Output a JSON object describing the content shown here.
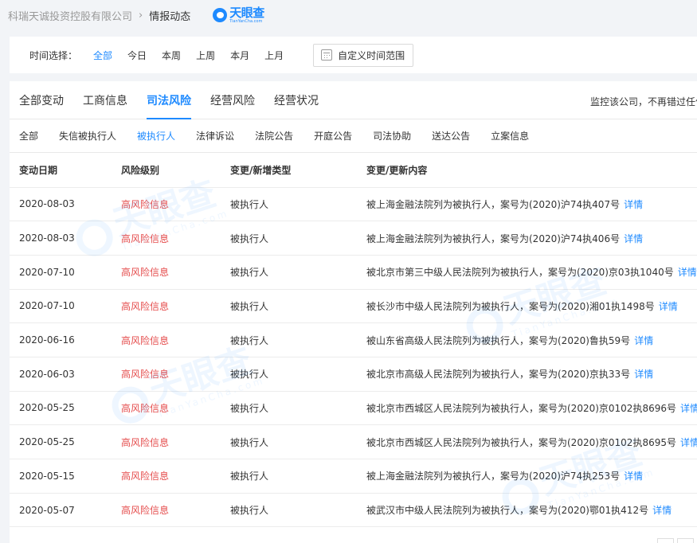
{
  "breadcrumb": {
    "company": "科瑞天诚投资控股有限公司",
    "separator": "›",
    "current": "情报动态"
  },
  "logo": {
    "name": "天眼查",
    "sub": "TianYanCha.com"
  },
  "filter": {
    "label": "时间选择：",
    "options": [
      "全部",
      "今日",
      "本周",
      "上周",
      "本月",
      "上月"
    ],
    "active_index": 0,
    "custom_range": "自定义时间范围"
  },
  "main_tabs": {
    "items": [
      "全部变动",
      "工商信息",
      "司法风险",
      "经营风险",
      "经营状况"
    ],
    "active_index": 2,
    "monitor_tip": "监控该公司，不再错过任何"
  },
  "sub_tabs": {
    "items": [
      "全部",
      "失信被执行人",
      "被执行人",
      "法律诉讼",
      "法院公告",
      "开庭公告",
      "司法协助",
      "送达公告",
      "立案信息"
    ],
    "active_index": 2
  },
  "table": {
    "headers": [
      "变动日期",
      "风险级别",
      "变更/新增类型",
      "变更/更新内容"
    ],
    "detail_label": "详情",
    "rows": [
      {
        "date": "2020-08-03",
        "risk": "高风险信息",
        "type": "被执行人",
        "content": "被上海金融法院列为被执行人，案号为(2020)沪74执407号"
      },
      {
        "date": "2020-08-03",
        "risk": "高风险信息",
        "type": "被执行人",
        "content": "被上海金融法院列为被执行人，案号为(2020)沪74执406号"
      },
      {
        "date": "2020-07-10",
        "risk": "高风险信息",
        "type": "被执行人",
        "content": "被北京市第三中级人民法院列为被执行人，案号为(2020)京03执1040号"
      },
      {
        "date": "2020-07-10",
        "risk": "高风险信息",
        "type": "被执行人",
        "content": "被长沙市中级人民法院列为被执行人，案号为(2020)湘01执1498号"
      },
      {
        "date": "2020-06-16",
        "risk": "高风险信息",
        "type": "被执行人",
        "content": "被山东省高级人民法院列为被执行人，案号为(2020)鲁执59号"
      },
      {
        "date": "2020-06-03",
        "risk": "高风险信息",
        "type": "被执行人",
        "content": "被北京市高级人民法院列为被执行人，案号为(2020)京执33号"
      },
      {
        "date": "2020-05-25",
        "risk": "高风险信息",
        "type": "被执行人",
        "content": "被北京市西城区人民法院列为被执行人，案号为(2020)京0102执8696号"
      },
      {
        "date": "2020-05-25",
        "risk": "高风险信息",
        "type": "被执行人",
        "content": "被北京市西城区人民法院列为被执行人，案号为(2020)京0102执8695号"
      },
      {
        "date": "2020-05-15",
        "risk": "高风险信息",
        "type": "被执行人",
        "content": "被上海金融法院列为被执行人，案号为(2020)沪74执253号"
      },
      {
        "date": "2020-05-07",
        "risk": "高风险信息",
        "type": "被执行人",
        "content": "被武汉市中级人民法院列为被执行人，案号为(2020)鄂01执412号"
      }
    ]
  },
  "watermark": {
    "text": "天眼查",
    "sub": "TianYanCha.com"
  },
  "colors": {
    "accent": "#1e8aff",
    "risk": "#e54d4d"
  }
}
